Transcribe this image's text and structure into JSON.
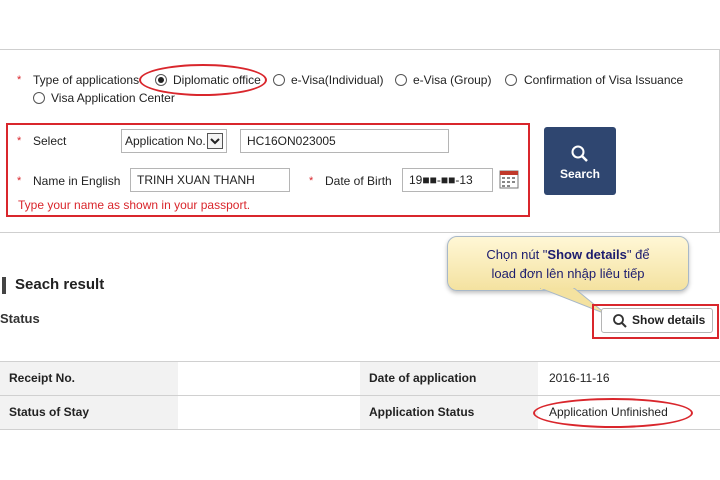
{
  "form": {
    "type_label": "Type of applications",
    "types": [
      "Diplomatic office",
      "e-Visa(Individual)",
      "e-Visa (Group)",
      "Confirmation of Visa Issuance",
      "Visa Application Center"
    ],
    "selected_type": "Diplomatic office",
    "select_label": "Select",
    "select_value": "Application No.",
    "application_no": "HC16ON023005",
    "name_label": "Name in English",
    "name_value": "TRINH XUAN THANH",
    "dob_label": "Date of Birth",
    "dob_value": "19■■-■■-13",
    "hint": "Type your name as shown in your passport.",
    "search_label": "Search"
  },
  "tooltip": {
    "line1_pre": "Chọn nút \"",
    "line1_bold": "Show details",
    "line1_post": "\" để",
    "line2": "load đơn lên nhập liêu tiếp"
  },
  "result": {
    "title": "Seach result",
    "status_label": "Status",
    "show_details_label": "Show details",
    "rows": [
      {
        "h1": "Receipt No.",
        "v1": "",
        "h2": "Date of application",
        "v2": "2016-11-16"
      },
      {
        "h1": "Status of Stay",
        "v1": "",
        "h2": "Application Status",
        "v2": "Application Unfinished"
      }
    ]
  },
  "colors": {
    "accent_red": "#d9262c",
    "search_button": "#2f4670"
  }
}
